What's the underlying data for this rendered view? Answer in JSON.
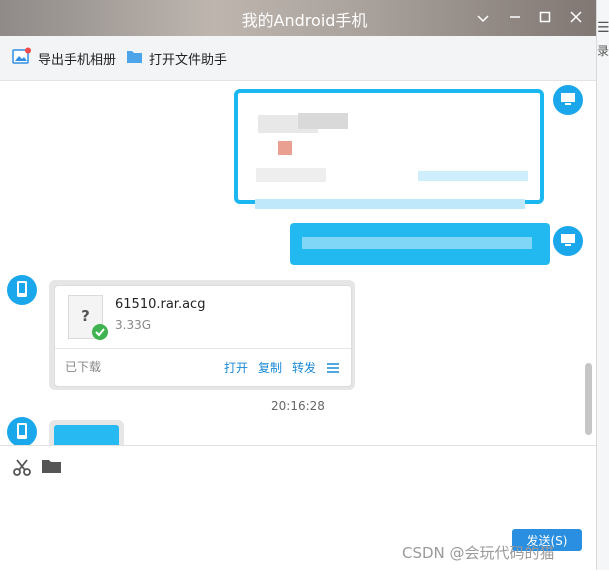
{
  "window": {
    "title": "我的Android手机",
    "controls": [
      "chevron-down-icon",
      "minimize-icon",
      "maximize-icon",
      "close-icon"
    ]
  },
  "toolbar": {
    "export_album": "导出手机相册",
    "open_file_helper": "打开文件助手"
  },
  "edge": {
    "label": "录"
  },
  "chat": {
    "file_message": {
      "file_name": "61510.rar.acg",
      "file_size": "3.33G",
      "status": "已下载",
      "actions": {
        "open": "打开",
        "copy": "复制",
        "forward": "转发"
      }
    },
    "timestamp": "20:16:28"
  },
  "input": {
    "send_label": "发送(S)"
  },
  "watermark": "CSDN @会玩代码的猫",
  "colors": {
    "accent": "#1ab7f0",
    "link": "#1a8ad6",
    "send_button": "#2a8fe0",
    "success": "#3fb34f"
  }
}
